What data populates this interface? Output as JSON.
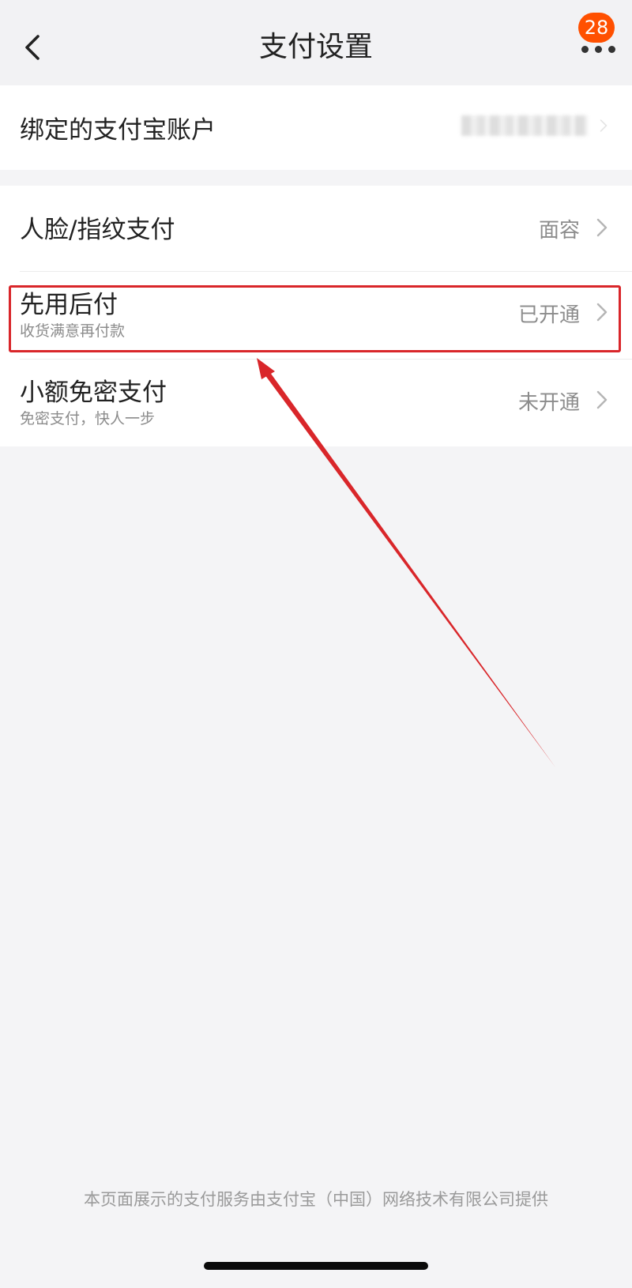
{
  "header": {
    "title": "支付设置",
    "badge_count": "28"
  },
  "account": {
    "label": "绑定的支付宝账户"
  },
  "settings": [
    {
      "label": "人脸/指纹支付",
      "subtitle": "",
      "value": "面容"
    },
    {
      "label": "先用后付",
      "subtitle": "收货满意再付款",
      "value": "已开通"
    },
    {
      "label": "小额免密支付",
      "subtitle": "免密支付，快人一步",
      "value": "未开通"
    }
  ],
  "footer": {
    "text": "本页面展示的支付服务由支付宝（中国）网络技术有限公司提供"
  },
  "colors": {
    "badge": "#ff5000",
    "annotation": "#d9262a",
    "background": "#f4f4f6"
  },
  "icons": [
    "back-arrow-icon",
    "more-dots-icon",
    "chevron-right-icon"
  ]
}
